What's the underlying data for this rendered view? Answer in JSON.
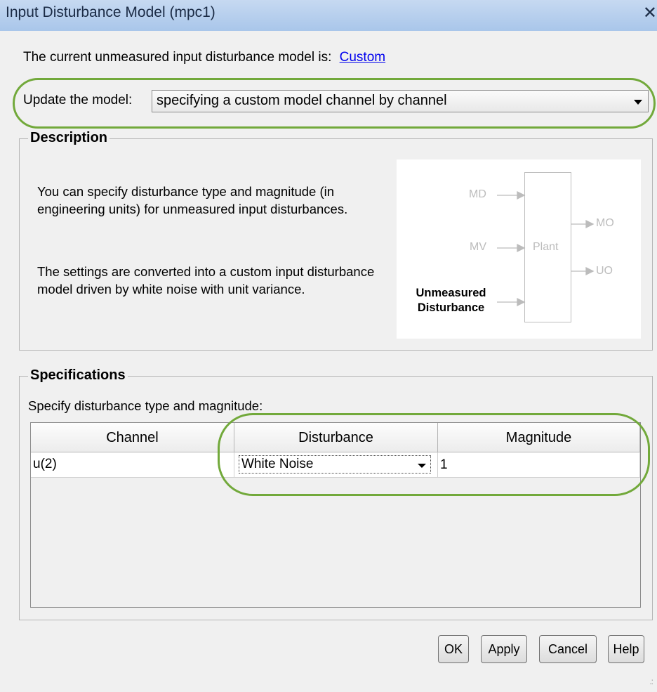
{
  "window": {
    "title": "Input Disturbance Model (mpc1)",
    "close_glyph": "✕"
  },
  "current_model": {
    "text": "The current unmeasured input disturbance model is:",
    "link": "Custom"
  },
  "update": {
    "label": "Update the model:",
    "selected": "specifying a custom model channel by channel"
  },
  "description": {
    "title": "Description",
    "para1": "You can specify disturbance type and magnitude (in engineering units) for unmeasured input disturbances.",
    "para2": "The settings are converted into a custom input disturbance model driven by white noise with unit variance.",
    "diagram": {
      "md": "MD",
      "mv": "MV",
      "unmeasured_line1": "Unmeasured",
      "unmeasured_line2": "Disturbance",
      "plant": "Plant",
      "mo": "MO",
      "uo": "UO"
    }
  },
  "specifications": {
    "title": "Specifications",
    "prompt": "Specify disturbance type and magnitude:",
    "columns": [
      "Channel",
      "Disturbance",
      "Magnitude"
    ],
    "rows": [
      {
        "channel": "u(2)",
        "disturbance": "White Noise",
        "magnitude": "1"
      }
    ]
  },
  "buttons": {
    "ok": "OK",
    "apply": "Apply",
    "cancel": "Cancel",
    "help": "Help"
  },
  "colors": {
    "highlight_ring": "#72a93b",
    "link": "#0000ee",
    "title_bar": "#b5cdee"
  }
}
